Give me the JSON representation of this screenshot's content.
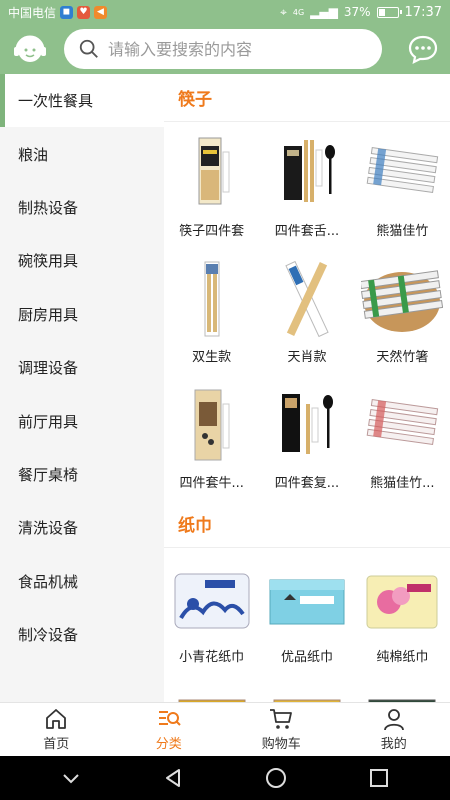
{
  "status": {
    "carrier": "中国电信",
    "battery": "37%",
    "battery_level": 0.37,
    "time": "17:37",
    "network": "4G"
  },
  "search": {
    "placeholder": "请输入要搜索的内容"
  },
  "sidebar": {
    "items": [
      {
        "label": "一次性餐具"
      },
      {
        "label": "粮油"
      },
      {
        "label": "制热设备"
      },
      {
        "label": "碗筷用具"
      },
      {
        "label": "厨房用具"
      },
      {
        "label": "调理设备"
      },
      {
        "label": "前厅用具"
      },
      {
        "label": "餐厅桌椅"
      },
      {
        "label": "清洗设备"
      },
      {
        "label": "食品机械"
      },
      {
        "label": "制冷设备"
      }
    ]
  },
  "sections": [
    {
      "title": "筷子",
      "items": [
        {
          "name": "筷子四件套",
          "icon": "chopstick-set-icon"
        },
        {
          "name": "四件套舌...",
          "icon": "cutlery-set-icon"
        },
        {
          "name": "熊猫佳竹",
          "icon": "chopstick-bundle-icon"
        },
        {
          "name": "双生款",
          "icon": "chopstick-pair-icon"
        },
        {
          "name": "天肖款",
          "icon": "crossed-chopsticks-icon"
        },
        {
          "name": "天然竹箸",
          "icon": "bamboo-basket-icon"
        },
        {
          "name": "四件套牛...",
          "icon": "chopstick-set-icon"
        },
        {
          "name": "四件套复...",
          "icon": "cutlery-set-icon"
        },
        {
          "name": "熊猫佳竹...",
          "icon": "chopstick-bundle-icon"
        }
      ]
    },
    {
      "title": "纸巾",
      "items": [
        {
          "name": "小青花纸巾",
          "icon": "tissue-pack-icon"
        },
        {
          "name": "优品纸巾",
          "icon": "tissue-box-icon"
        },
        {
          "name": "纯棉纸巾",
          "icon": "tissue-pack-pink-icon"
        },
        {
          "name": "",
          "icon": "tissue-box-yellow-icon"
        },
        {
          "name": "",
          "icon": "tissue-box-yellow-icon"
        },
        {
          "name": "",
          "icon": "tissue-box-dark-icon"
        }
      ]
    }
  ],
  "tabs": [
    {
      "label": "首页",
      "icon": "home-icon"
    },
    {
      "label": "分类",
      "icon": "category-icon"
    },
    {
      "label": "购物车",
      "icon": "cart-icon"
    },
    {
      "label": "我的",
      "icon": "profile-icon"
    }
  ],
  "colors": {
    "brand": "#8fc08c",
    "accent": "#ef7a1c",
    "sidebar_bg": "#f5f5f5"
  }
}
